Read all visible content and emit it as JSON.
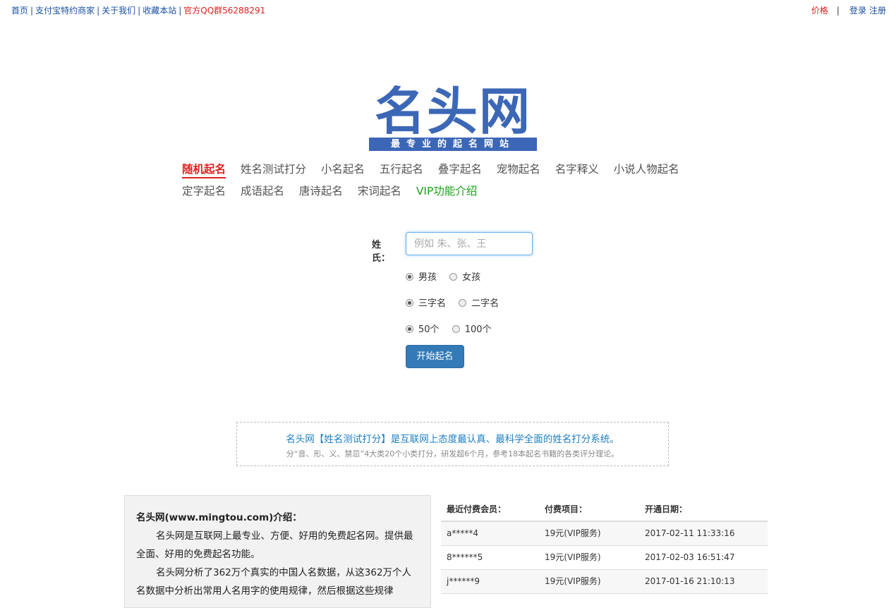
{
  "topbar": {
    "links": [
      "首页",
      "支付宝特约商家",
      "关于我们",
      "收藏本站"
    ],
    "qq_group": "官方QQ群56288291",
    "price": "价格",
    "divider": "|",
    "login": "登录",
    "register": "注册"
  },
  "logo": {
    "title": "名头网",
    "tagline": "最专业的起名网站"
  },
  "nav": {
    "row1": [
      "随机起名",
      "姓名测试打分",
      "小名起名",
      "五行起名",
      "叠字起名",
      "宠物起名",
      "名字释义",
      "小说人物起名"
    ],
    "row2": [
      "定字起名",
      "成语起名",
      "唐诗起名",
      "宋词起名",
      "VIP功能介绍"
    ]
  },
  "form": {
    "surname_label": "姓氏：",
    "surname_placeholder": "例如 朱、张、王",
    "gender": {
      "option1": "男孩",
      "option2": "女孩",
      "selected": "男孩"
    },
    "length": {
      "option1": "三字名",
      "option2": "二字名",
      "selected": "三字名"
    },
    "count": {
      "option1": "50个",
      "option2": "100个",
      "selected": "50个"
    },
    "submit": "开始起名"
  },
  "promo": {
    "line1": "名头网【姓名测试打分】是互联网上态度最认真、最科学全面的姓名打分系统。",
    "line2": "分“音、形、义、禁忌”4大类20个小类打分，研发超6个月，参考18本起名书籍的各类评分理论。"
  },
  "intro": {
    "title": "名头网(www.mingtou.com)介绍：",
    "p1": "名头网是互联网上最专业、方便、好用的免费起名网。提供最全面、好用的免费起名功能。",
    "p2": "名头网分析了362万个真实的中国人名数据，从这362万个人名数据中分析出常用人名用字的使用规律，然后根据这些规律"
  },
  "members": {
    "headers": [
      "最近付费会员：",
      "付费项目：",
      "开通日期："
    ],
    "rows": [
      {
        "user": "a*****4",
        "item": "19元(VIP服务)",
        "date": "2017-02-11 11:33:16"
      },
      {
        "user": "8******5",
        "item": "19元(VIP服务)",
        "date": "2017-02-03 16:51:47"
      },
      {
        "user": "j******9",
        "item": "19元(VIP服务)",
        "date": "2017-01-16 21:10:13"
      }
    ]
  }
}
